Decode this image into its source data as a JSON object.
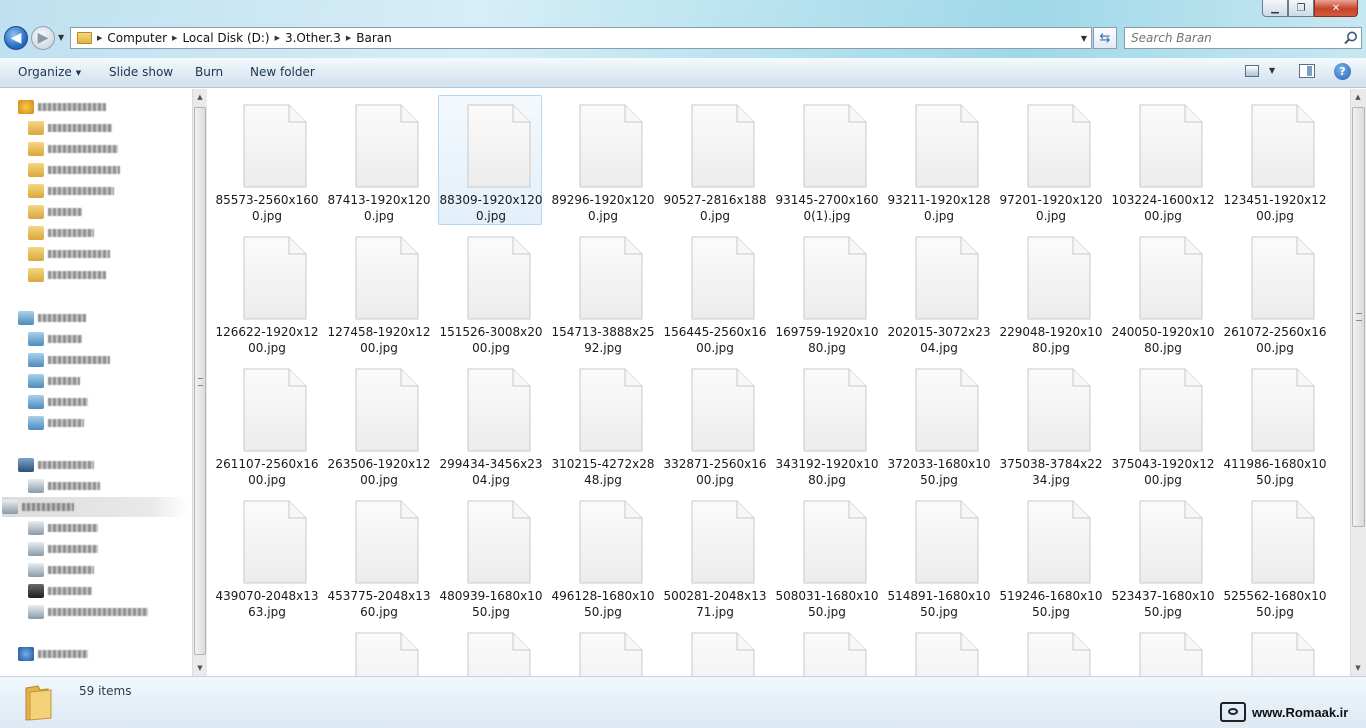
{
  "window": {
    "minimize_glyph": "▁",
    "maximize_glyph": "❐",
    "close_glyph": "✕"
  },
  "address_bar": {
    "crumbs": [
      "Computer",
      "Local Disk (D:)",
      "3.Other.3",
      "Baran"
    ]
  },
  "search": {
    "placeholder": "Search Baran"
  },
  "toolbar": {
    "organize": "Organize",
    "slideshow": "Slide show",
    "burn": "Burn",
    "new_folder": "New folder"
  },
  "nav_pane": {
    "note": "labels are blurred/illegible in the screenshot",
    "items": [
      {
        "icon": "star-icon"
      },
      {
        "icon": "folder-icon"
      },
      {
        "icon": "folder-icon"
      },
      {
        "icon": "folder-icon"
      },
      {
        "icon": "folder-icon"
      },
      {
        "icon": "folder-icon"
      },
      {
        "icon": "folder-icon"
      },
      {
        "icon": "folder-icon"
      },
      {
        "icon": "folder-icon"
      },
      {
        "icon": "library-icon"
      },
      {
        "icon": "library-icon"
      },
      {
        "icon": "library-icon"
      },
      {
        "icon": "library-icon"
      },
      {
        "icon": "library-icon"
      },
      {
        "icon": "library-icon"
      },
      {
        "icon": "computer-icon"
      },
      {
        "icon": "drive-icon"
      },
      {
        "icon": "drive-icon"
      },
      {
        "icon": "drive-icon"
      },
      {
        "icon": "drive-icon"
      },
      {
        "icon": "drive-icon"
      },
      {
        "icon": "drive-icon"
      },
      {
        "icon": "drive-icon"
      },
      {
        "icon": "network-icon"
      }
    ]
  },
  "files": [
    "85573-2560x1600.jpg",
    "87413-1920x1200.jpg",
    "88309-1920x1200.jpg",
    "89296-1920x1200.jpg",
    "90527-2816x1880.jpg",
    "93145-2700x1600(1).jpg",
    "93211-1920x1280.jpg",
    "97201-1920x1200.jpg",
    "103224-1600x1200.jpg",
    "123451-1920x1200.jpg",
    "126622-1920x1200.jpg",
    "127458-1920x1200.jpg",
    "151526-3008x2000.jpg",
    "154713-3888x2592.jpg",
    "156445-2560x1600.jpg",
    "169759-1920x1080.jpg",
    "202015-3072x2304.jpg",
    "229048-1920x1080.jpg",
    "240050-1920x1080.jpg",
    "261072-2560x1600.jpg",
    "261107-2560x1600.jpg",
    "263506-1920x1200.jpg",
    "299434-3456x2304.jpg",
    "310215-4272x2848.jpg",
    "332871-2560x1600.jpg",
    "343192-1920x1080.jpg",
    "372033-1680x1050.jpg",
    "375038-3784x2234.jpg",
    "375043-1920x1200.jpg",
    "411986-1680x1050.jpg",
    "439070-2048x1363.jpg",
    "453775-2048x1360.jpg",
    "480939-1680x1050.jpg",
    "496128-1680x1050.jpg",
    "500281-2048x1371.jpg",
    "508031-1680x1050.jpg",
    "514891-1680x1050.jpg",
    "519246-1680x1050.jpg",
    "523437-1680x1050.jpg",
    "525562-1680x1050.jpg"
  ],
  "partial_row_count": 9,
  "selected_file_index": 2,
  "status": {
    "item_count": "59 items"
  },
  "watermark": {
    "text": "www.Romaak.ir"
  }
}
